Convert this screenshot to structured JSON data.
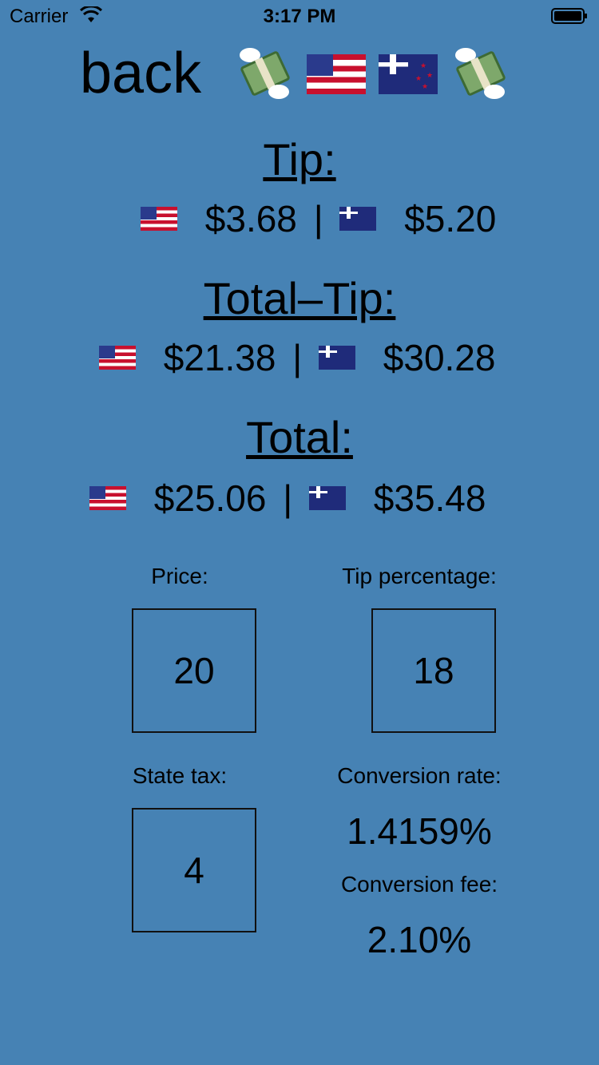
{
  "status_bar": {
    "carrier": "Carrier",
    "time": "3:17 PM"
  },
  "header": {
    "back_label": "back"
  },
  "tip": {
    "title": "Tip:",
    "usd": "$3.68",
    "separator": "|",
    "nzd": "$5.20"
  },
  "total_minus_tip": {
    "title": "Total–Tip:",
    "usd": "$21.38",
    "separator": "|",
    "nzd": "$30.28"
  },
  "total": {
    "title": "Total:",
    "usd": "$25.06",
    "separator": "|",
    "nzd": "$35.48"
  },
  "inputs": {
    "price_label": "Price:",
    "price_value": "20",
    "tip_percentage_label": "Tip percentage:",
    "tip_percentage_value": "18",
    "state_tax_label": "State tax:",
    "state_tax_value": "4"
  },
  "conversion": {
    "rate_label": "Conversion rate:",
    "rate_value": "1.4159%",
    "fee_label": "Conversion fee:",
    "fee_value": "2.10%"
  },
  "colors": {
    "background": "#4682B4",
    "text": "#000000",
    "box_border": "#111111"
  },
  "icons": [
    "wifi-icon",
    "battery-icon",
    "money-with-wings-icon",
    "us-flag-icon",
    "nz-flag-icon"
  ]
}
